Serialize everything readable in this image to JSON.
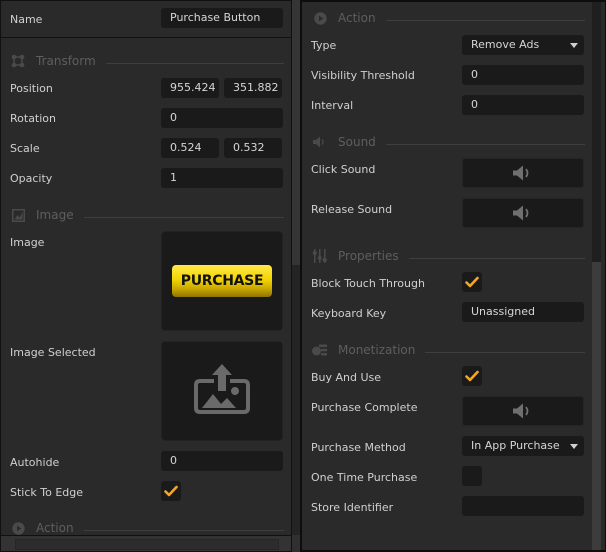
{
  "left": {
    "name": {
      "label": "Name",
      "value": "Purchase Button"
    },
    "transform": {
      "title": "Transform",
      "icon": "transform-icon",
      "position": {
        "label": "Position",
        "x": "955.424",
        "y": "351.882"
      },
      "rotation": {
        "label": "Rotation",
        "value": "0"
      },
      "scale": {
        "label": "Scale",
        "x": "0.524",
        "y": "0.532"
      },
      "opacity": {
        "label": "Opacity",
        "value": "1"
      }
    },
    "image": {
      "title": "Image",
      "icon": "image-icon",
      "image": {
        "label": "Image",
        "preview_text": "PURCHASE"
      },
      "image_selected": {
        "label": "Image Selected",
        "placeholder_icon": "upload-image-icon"
      },
      "autohide": {
        "label": "Autohide",
        "value": "0"
      },
      "stick_to_edge": {
        "label": "Stick To Edge",
        "checked": true
      }
    },
    "action_partial": {
      "title": "Action",
      "icon": "play-icon"
    }
  },
  "right": {
    "action": {
      "title": "Action",
      "icon": "play-icon",
      "type": {
        "label": "Type",
        "value": "Remove Ads"
      },
      "visibility_threshold": {
        "label": "Visibility Threshold",
        "value": "0"
      },
      "interval": {
        "label": "Interval",
        "value": "0"
      }
    },
    "sound": {
      "title": "Sound",
      "icon": "speaker-icon",
      "click_sound": {
        "label": "Click Sound"
      },
      "release_sound": {
        "label": "Release Sound"
      }
    },
    "properties": {
      "title": "Properties",
      "icon": "sliders-icon",
      "block_touch_through": {
        "label": "Block Touch Through",
        "checked": true
      },
      "keyboard_key": {
        "label": "Keyboard Key",
        "value": "Unassigned"
      }
    },
    "monetization": {
      "title": "Monetization",
      "icon": "monetization-icon",
      "buy_and_use": {
        "label": "Buy And Use",
        "checked": true
      },
      "purchase_complete": {
        "label": "Purchase Complete"
      },
      "purchase_method": {
        "label": "Purchase Method",
        "value": "In App Purchase"
      },
      "one_time_purchase": {
        "label": "One Time Purchase",
        "checked": false
      },
      "store_identifier": {
        "label": "Store Identifier",
        "value": ""
      }
    }
  },
  "colors": {
    "accent_check": "#f5a623",
    "panel_bg": "#2a2a2a",
    "field_bg": "#1a1a1a",
    "section_title": "#5e5e5e"
  }
}
